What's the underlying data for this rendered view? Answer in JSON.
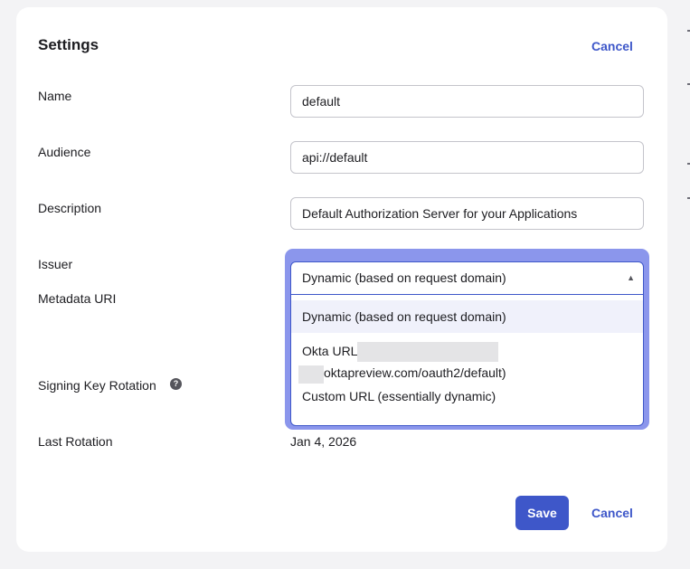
{
  "header": {
    "title": "Settings",
    "cancel_label": "Cancel"
  },
  "fields": {
    "name": {
      "label": "Name",
      "value": "default"
    },
    "audience": {
      "label": "Audience",
      "value": "api://default"
    },
    "description": {
      "label": "Description",
      "value": "Default Authorization Server for your Applications"
    },
    "issuer": {
      "label": "Issuer",
      "selected": "Dynamic (based on request domain)",
      "options": [
        "Dynamic (based on request domain)",
        "Okta URL",
        "Custom URL (essentially dynamic)"
      ],
      "okta_url_suffix": "oktapreview.com/oauth2/default)"
    },
    "metadata_uri": {
      "label": "Metadata URI"
    },
    "signing_key_rotation": {
      "label": "Signing Key Rotation",
      "help_glyph": "?"
    },
    "last_rotation": {
      "label": "Last Rotation",
      "value": "Jan 4, 2026"
    }
  },
  "footer": {
    "save_label": "Save",
    "cancel_label": "Cancel"
  },
  "colors": {
    "accent": "#3e57c9",
    "focus_ring": "#8b96ec",
    "selected_option_bg": "#f0f1fb"
  },
  "icons": {
    "dropdown_caret": "caret-up-icon",
    "help": "question-circle-icon"
  }
}
